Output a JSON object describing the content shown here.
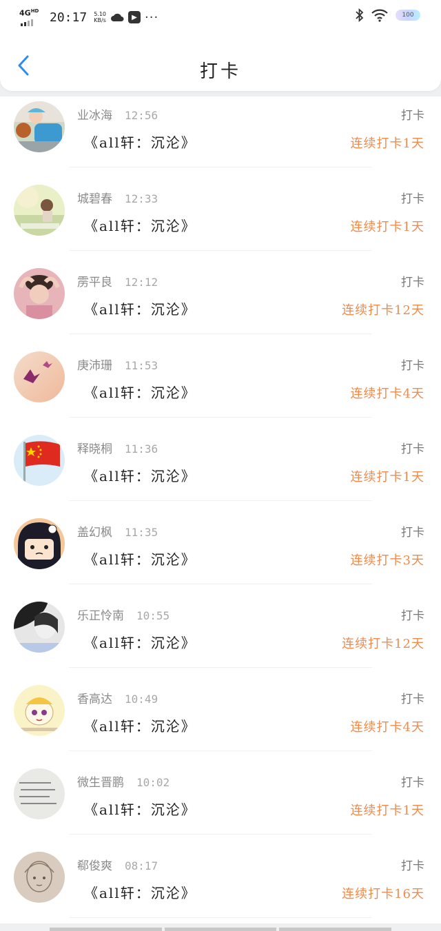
{
  "status_bar": {
    "network": "4G",
    "network_sup": "HD",
    "time": "20:17",
    "speed_value": "5.10",
    "speed_unit": "KB/s",
    "battery": "100"
  },
  "header": {
    "title": "打卡"
  },
  "colors": {
    "streak": "#f08a4b",
    "back_arrow": "#2d8cf0",
    "divider": "#f0f0f0"
  },
  "items": [
    {
      "name": "业冰海",
      "time": "12:56",
      "label": "打卡",
      "message": "《all轩：沉沦》",
      "streak": "连续打卡1天"
    },
    {
      "name": "城碧春",
      "time": "12:33",
      "label": "打卡",
      "message": "《all轩：沉沦》",
      "streak": "连续打卡1天"
    },
    {
      "name": "雳平良",
      "time": "12:12",
      "label": "打卡",
      "message": "《all轩：沉沦》",
      "streak": "连续打卡12天"
    },
    {
      "name": "庚沛珊",
      "time": "11:53",
      "label": "打卡",
      "message": "《all轩：沉沦》",
      "streak": "连续打卡4天"
    },
    {
      "name": "释晓桐",
      "time": "11:36",
      "label": "打卡",
      "message": "《all轩：沉沦》",
      "streak": "连续打卡1天"
    },
    {
      "name": "盖幻枫",
      "time": "11:35",
      "label": "打卡",
      "message": "《all轩：沉沦》",
      "streak": "连续打卡3天"
    },
    {
      "name": "乐正怜南",
      "time": "10:55",
      "label": "打卡",
      "message": "《all轩：沉沦》",
      "streak": "连续打卡12天"
    },
    {
      "name": "香高达",
      "time": "10:49",
      "label": "打卡",
      "message": "《all轩：沉沦》",
      "streak": "连续打卡4天"
    },
    {
      "name": "微生晋鹏",
      "time": "10:02",
      "label": "打卡",
      "message": "《all轩：沉沦》",
      "streak": "连续打卡1天"
    },
    {
      "name": "郗俊爽",
      "time": "08:17",
      "label": "打卡",
      "message": "《all轩：沉沦》",
      "streak": "连续打卡16天"
    }
  ]
}
